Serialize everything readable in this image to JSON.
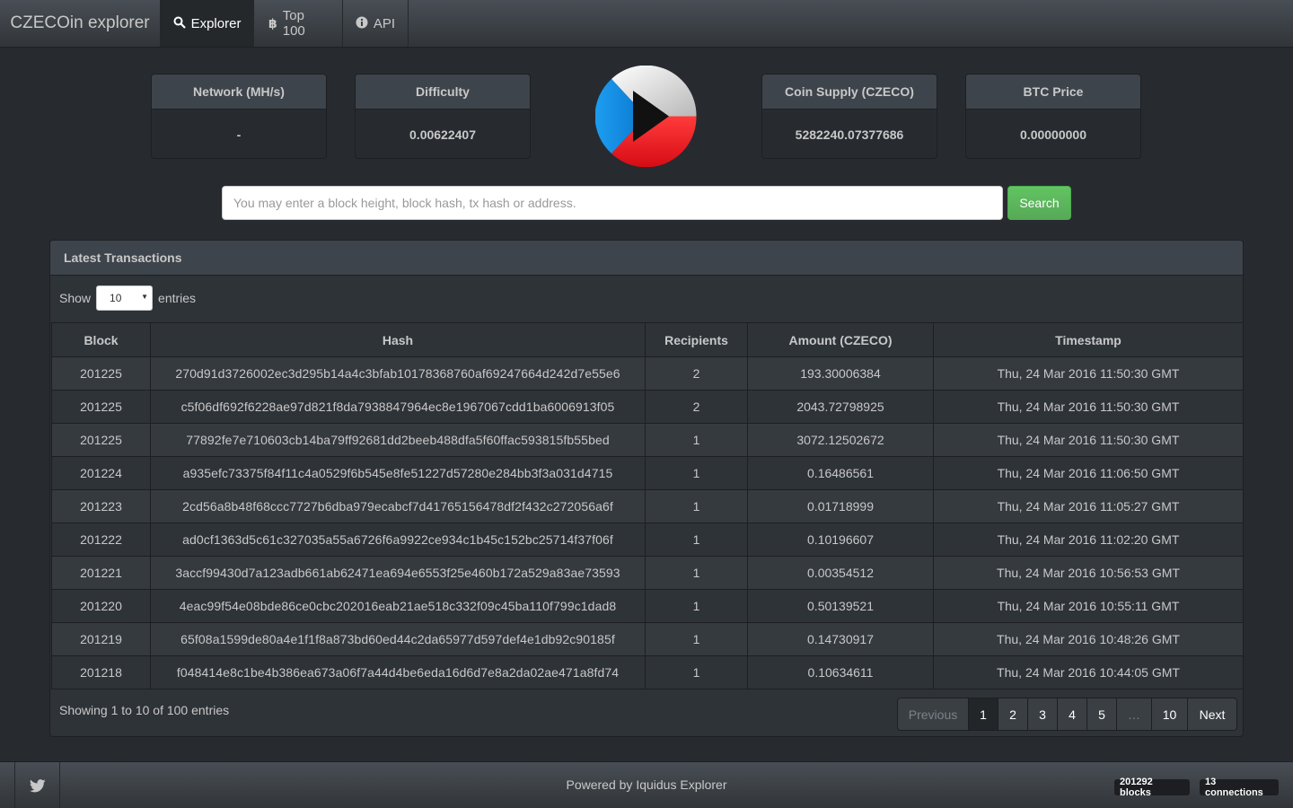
{
  "nav": {
    "brand": "CZECOin explorer",
    "items": [
      {
        "label": "Explorer",
        "icon": "search-icon"
      },
      {
        "label": "Top 100",
        "icon": "bitcoin-icon"
      },
      {
        "label": "API",
        "icon": "info-icon"
      }
    ]
  },
  "stats": {
    "network": {
      "label": "Network (MH/s)",
      "value": "-"
    },
    "difficulty": {
      "label": "Difficulty",
      "value": "0.00622407"
    },
    "supply": {
      "label": "Coin Supply (CZECO)",
      "value": "5282240.07377686"
    },
    "btc_price": {
      "label": "BTC Price",
      "value": "0.00000000"
    }
  },
  "search": {
    "placeholder": "You may enter a block height, block hash, tx hash or address.",
    "button": "Search"
  },
  "panel": {
    "title": "Latest Transactions",
    "show_label": "Show",
    "length_value": "10",
    "entries_label": "entries",
    "columns": [
      "Block",
      "Hash",
      "Recipients",
      "Amount (CZECO)",
      "Timestamp"
    ],
    "rows": [
      [
        "201225",
        "270d91d3726002ec3d295b14a4c3bfab10178368760af69247664d242d7e55e6",
        "2",
        "193.30006384",
        "Thu, 24 Mar 2016 11:50:30 GMT"
      ],
      [
        "201225",
        "c5f06df692f6228ae97d821f8da7938847964ec8e1967067cdd1ba6006913f05",
        "2",
        "2043.72798925",
        "Thu, 24 Mar 2016 11:50:30 GMT"
      ],
      [
        "201225",
        "77892fe7e710603cb14ba79ff92681dd2beeb488dfa5f60ffac593815fb55bed",
        "1",
        "3072.12502672",
        "Thu, 24 Mar 2016 11:50:30 GMT"
      ],
      [
        "201224",
        "a935efc73375f84f11c4a0529f6b545e8fe51227d57280e284bb3f3a031d4715",
        "1",
        "0.16486561",
        "Thu, 24 Mar 2016 11:06:50 GMT"
      ],
      [
        "201223",
        "2cd56a8b48f68ccc7727b6dba979ecabcf7d41765156478df2f432c272056a6f",
        "1",
        "0.01718999",
        "Thu, 24 Mar 2016 11:05:27 GMT"
      ],
      [
        "201222",
        "ad0cf1363d5c61c327035a55a6726f6a9922ce934c1b45c152bc25714f37f06f",
        "1",
        "0.10196607",
        "Thu, 24 Mar 2016 11:02:20 GMT"
      ],
      [
        "201221",
        "3accf99430d7a123adb661ab62471ea694e6553f25e460b172a529a83ae73593",
        "1",
        "0.00354512",
        "Thu, 24 Mar 2016 10:56:53 GMT"
      ],
      [
        "201220",
        "4eac99f54e08bde86ce0cbc202016eab21ae518c332f09c45ba110f799c1dad8",
        "1",
        "0.50139521",
        "Thu, 24 Mar 2016 10:55:11 GMT"
      ],
      [
        "201219",
        "65f08a1599de80a4e1f1f8a873bd60ed44c2da65977d597def4e1db92c90185f",
        "1",
        "0.14730917",
        "Thu, 24 Mar 2016 10:48:26 GMT"
      ],
      [
        "201218",
        "f048414e8c1be4b386ea673a06f7a44d4be6eda16d6d7e8a2da02ae471a8fd74",
        "1",
        "0.10634611",
        "Thu, 24 Mar 2016 10:44:05 GMT"
      ]
    ],
    "info": "Showing 1 to 10 of 100 entries",
    "pager": [
      "Previous",
      "1",
      "2",
      "3",
      "4",
      "5",
      "…",
      "10",
      "Next"
    ]
  },
  "footer": {
    "powered": "Powered by Iquidus Explorer",
    "blocks": "201292 blocks",
    "connections": "13 connections"
  },
  "colors": {
    "background": "#272b30",
    "panel": "#2e3338",
    "header": "#3e444c",
    "search_button": "#62c462"
  }
}
